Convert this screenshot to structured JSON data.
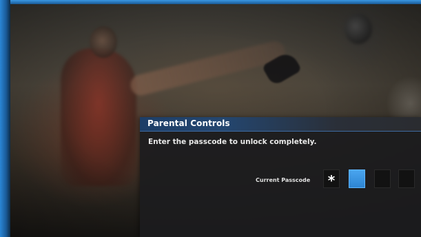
{
  "dialog": {
    "title": "Parental Controls",
    "message": "Enter the passcode to unlock completely.",
    "passcode_label": "Current Passcode",
    "digits": [
      {
        "display": "*",
        "state": "filled"
      },
      {
        "display": "",
        "state": "active"
      },
      {
        "display": "",
        "state": "empty"
      },
      {
        "display": "",
        "state": "empty"
      }
    ]
  },
  "colors": {
    "accent": "#2d84d2",
    "title_bar": "#1d3e67",
    "dialog_bg": "#1c1c1e",
    "frame": "#2a86d6"
  }
}
